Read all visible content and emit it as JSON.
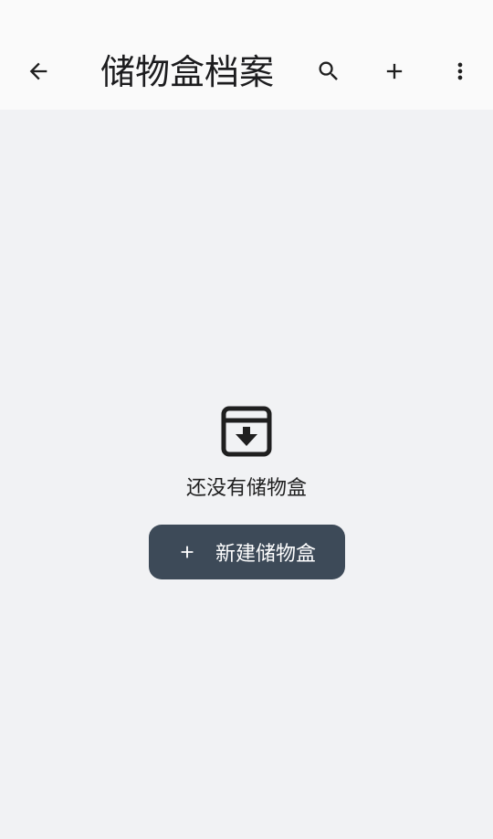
{
  "app_bar": {
    "title": "储物盒档案",
    "icons": {
      "back": "arrow-back-icon",
      "search": "search-icon",
      "add": "plus-icon",
      "more": "more-vert-icon"
    }
  },
  "empty_state": {
    "icon": "archive-download-icon",
    "message": "还没有储物盒",
    "button_label": "新建储物盒",
    "button_icon": "plus-icon"
  },
  "colors": {
    "app_bar_bg": "#fafafa",
    "content_bg": "#f1f2f4",
    "button_bg": "#3d4a58",
    "button_text": "#ffffff",
    "icon": "#1f1f1f"
  }
}
